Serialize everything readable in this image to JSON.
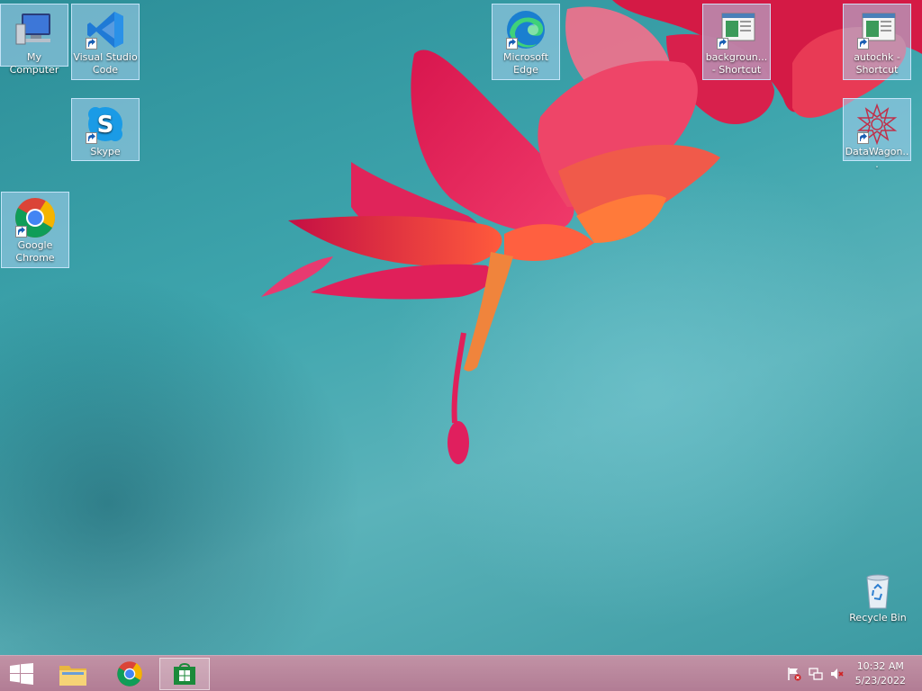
{
  "desktop": {
    "icons": [
      {
        "label": "My Computer"
      },
      {
        "label": "Visual Studio Code"
      },
      {
        "label": "Skype"
      },
      {
        "label": "Google Chrome"
      },
      {
        "label": "Microsoft Edge"
      },
      {
        "label": "backgroun... - Shortcut"
      },
      {
        "label": "autochk - Shortcut"
      },
      {
        "label": "DataWagon..."
      },
      {
        "label": "Recycle Bin"
      }
    ]
  },
  "taskbar": {
    "pinned": [
      {
        "name": "Start",
        "icon": "windows-logo-icon"
      },
      {
        "name": "File Explorer",
        "icon": "folder-icon"
      },
      {
        "name": "Google Chrome",
        "icon": "chrome-icon"
      },
      {
        "name": "Store",
        "icon": "store-icon",
        "active": true
      }
    ],
    "tray": [
      "action-center-flag-icon",
      "network-icon",
      "volume-muted-icon"
    ],
    "clock": {
      "time": "10:32 AM",
      "date": "5/23/2022"
    }
  },
  "colors": {
    "wallpaper_teal": "#3ea5ad",
    "flower_pink": "#e8205a",
    "taskbar": "#b47c94",
    "selection": "#aad2f0"
  }
}
